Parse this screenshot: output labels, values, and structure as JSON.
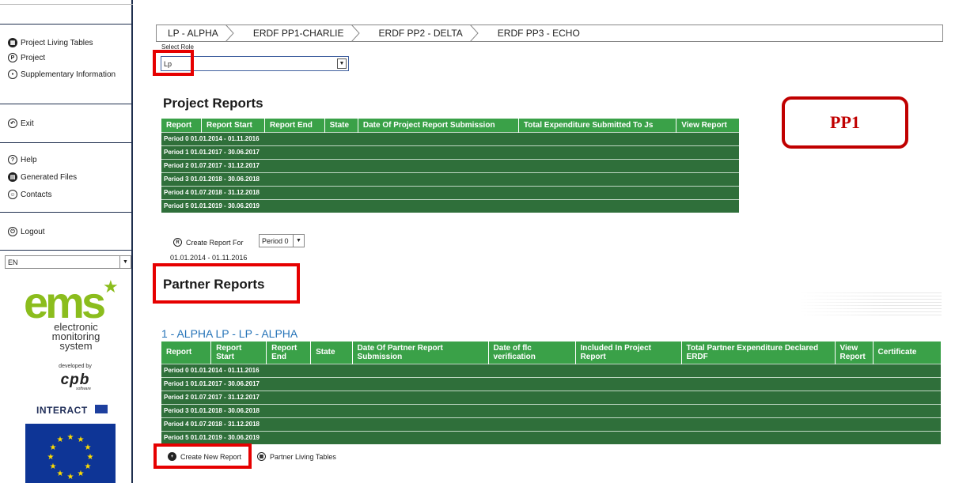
{
  "sidebar": {
    "nav_top": [
      {
        "label": "Project Living Tables",
        "icon": "table-icon"
      },
      {
        "label": "Project",
        "icon": "project-icon"
      },
      {
        "label": "Supplementary Information",
        "icon": "info-icon"
      }
    ],
    "exit_label": "Exit",
    "nav_help": [
      {
        "label": "Help",
        "icon": "help-icon"
      },
      {
        "label": "Generated Files",
        "icon": "files-icon"
      },
      {
        "label": "Contacts",
        "icon": "contacts-icon"
      }
    ],
    "logout_label": "Logout",
    "language": "EN",
    "logo": {
      "brand": "ems",
      "subtitle_lines": [
        "electronic",
        "monitoring",
        "system"
      ],
      "developed_by": "developed by",
      "company": "cpb",
      "company_sub": "software",
      "interact": "INTERACT"
    }
  },
  "tabs": [
    "LP - ALPHA",
    "ERDF PP1-CHARLIE",
    "ERDF PP2 - DELTA",
    "ERDF PP3 - ECHO"
  ],
  "role": {
    "label": "Select Role",
    "value": "Lp"
  },
  "callout": "PP1",
  "project_reports": {
    "title": "Project Reports",
    "columns": [
      "Report",
      "Report Start",
      "Report End",
      "State",
      "Date Of Project Report Submission",
      "Total Expenditure Submitted To Js",
      "View Report"
    ],
    "rows": [
      "Period 0 01.01.2014 - 01.11.2016",
      "Period 1 01.01.2017 - 30.06.2017",
      "Period 2 01.07.2017 - 31.12.2017",
      "Period 3 01.01.2018 - 30.06.2018",
      "Period 4 01.07.2018 - 31.12.2018",
      "Period 5 01.01.2019 - 30.06.2019"
    ]
  },
  "create_report": {
    "label": "Create Report For",
    "period": "Period 0",
    "dates": "01.01.2014 - 01.11.2016"
  },
  "partner_reports": {
    "title": "Partner Reports",
    "partner_heading": "1 - ALPHA LP - LP - ALPHA",
    "columns": [
      "Report",
      "Report Start",
      "Report End",
      "State",
      "Date Of Partner Report Submission",
      "Date of flc verification",
      "Included In Project Report",
      "Total Partner Expenditure Declared ERDF",
      "View Report",
      "Certificate"
    ],
    "rows": [
      "Period 0 01.01.2014 - 01.11.2016",
      "Period 1 01.01.2017 - 30.06.2017",
      "Period 2 01.07.2017 - 31.12.2017",
      "Period 3 01.01.2018 - 30.06.2018",
      "Period 4 01.07.2018 - 31.12.2018",
      "Period 5 01.01.2019 - 30.06.2019"
    ]
  },
  "buttons": {
    "create_new_report": "Create New Report",
    "partner_living_tables": "Partner Living Tables"
  },
  "colors": {
    "header_green": "#3aa148",
    "row_green": "#2f6f3a",
    "highlight_red": "#e60000",
    "link_blue": "#2573b8",
    "logo_green": "#8bbd1d"
  }
}
